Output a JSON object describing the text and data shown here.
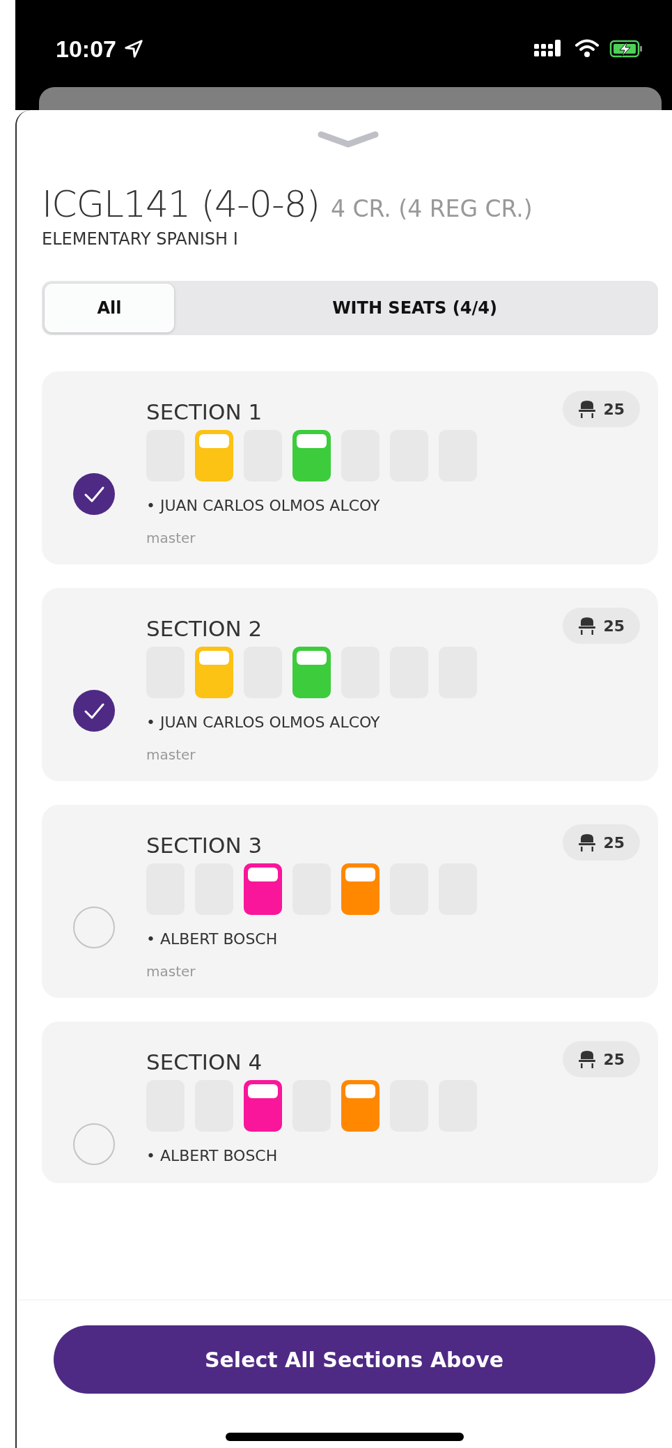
{
  "status_bar": {
    "time": "10:07"
  },
  "course": {
    "code": "ICGL141 (4-0-8)",
    "credits": "4 CR. (4 REG CR.)",
    "name": "ELEMENTARY SPANISH I"
  },
  "filters": [
    {
      "label": "All",
      "selected": true
    },
    {
      "label": "WITH SEATS (4/4)",
      "selected": false
    }
  ],
  "sections": [
    {
      "title": "SECTION 1",
      "seats": "25",
      "checked": true,
      "slots": [
        {
          "filled": false
        },
        {
          "filled": true,
          "color": "#fcc214"
        },
        {
          "filled": false
        },
        {
          "filled": true,
          "color": "#3ccc3c"
        },
        {
          "filled": false
        },
        {
          "filled": false
        },
        {
          "filled": false
        }
      ],
      "instructor": "• JUAN CARLOS OLMOS ALCOY",
      "note": "master"
    },
    {
      "title": "SECTION 2",
      "seats": "25",
      "checked": true,
      "slots": [
        {
          "filled": false
        },
        {
          "filled": true,
          "color": "#fcc214"
        },
        {
          "filled": false
        },
        {
          "filled": true,
          "color": "#3ccc3c"
        },
        {
          "filled": false
        },
        {
          "filled": false
        },
        {
          "filled": false
        }
      ],
      "instructor": "• JUAN CARLOS OLMOS ALCOY",
      "note": "master"
    },
    {
      "title": "SECTION 3",
      "seats": "25",
      "checked": false,
      "slots": [
        {
          "filled": false
        },
        {
          "filled": false
        },
        {
          "filled": true,
          "color": "#f9169a"
        },
        {
          "filled": false
        },
        {
          "filled": true,
          "color": "#ff8800"
        },
        {
          "filled": false
        },
        {
          "filled": false
        }
      ],
      "instructor": "• ALBERT BOSCH",
      "note": "master"
    },
    {
      "title": "SECTION 4",
      "seats": "25",
      "checked": false,
      "slots": [
        {
          "filled": false
        },
        {
          "filled": false
        },
        {
          "filled": true,
          "color": "#f9169a"
        },
        {
          "filled": false
        },
        {
          "filled": true,
          "color": "#ff8800"
        },
        {
          "filled": false
        },
        {
          "filled": false
        }
      ],
      "instructor": "• ALBERT BOSCH"
    }
  ],
  "action_button": "Select All Sections Above"
}
